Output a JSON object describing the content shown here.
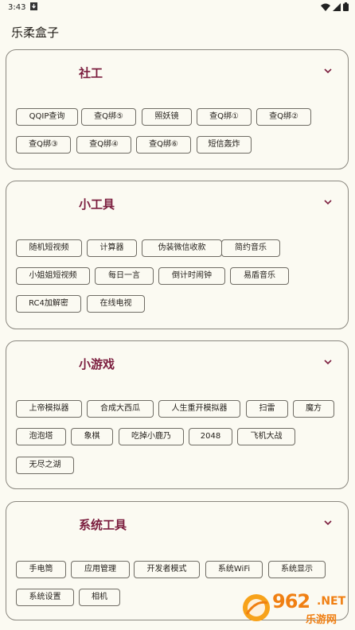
{
  "status": {
    "time": "3:43"
  },
  "app": {
    "title": "乐柔盒子"
  },
  "colors": {
    "accent": "#7b1d3e",
    "background": "#fbfaf2",
    "border": "#6f6c64"
  },
  "sections": [
    {
      "title": "社工",
      "chips": [
        "QQIP查询",
        "查Q绑⑤",
        "照妖镜",
        "查Q绑①",
        "查Q绑②",
        "查Q绑③",
        "查Q绑④",
        "查Q绑⑥",
        "短信轰炸"
      ]
    },
    {
      "title": "小工具",
      "chips": [
        "随机短视频",
        "计算器",
        "伪装微信收款",
        "简约音乐",
        "小姐姐短视频",
        "每日一言",
        "倒计时闹钟",
        "易盾音乐",
        "RC4加解密",
        "在线电视"
      ]
    },
    {
      "title": "小游戏",
      "chips": [
        "上帝模拟器",
        "合成大西瓜",
        "人生重开模拟器",
        "扫雷",
        "魔方",
        "泡泡塔",
        "象棋",
        "吃掉小鹿乃",
        "2048",
        "飞机大战",
        "无尽之湖"
      ]
    },
    {
      "title": "系统工具",
      "chips": [
        "手电筒",
        "应用管理",
        "开发者模式",
        "系统WiFi",
        "系统显示",
        "系统设置",
        "相机"
      ]
    }
  ],
  "watermark": {
    "number": "962",
    "suffix": ".NET",
    "brand": "乐游网"
  }
}
